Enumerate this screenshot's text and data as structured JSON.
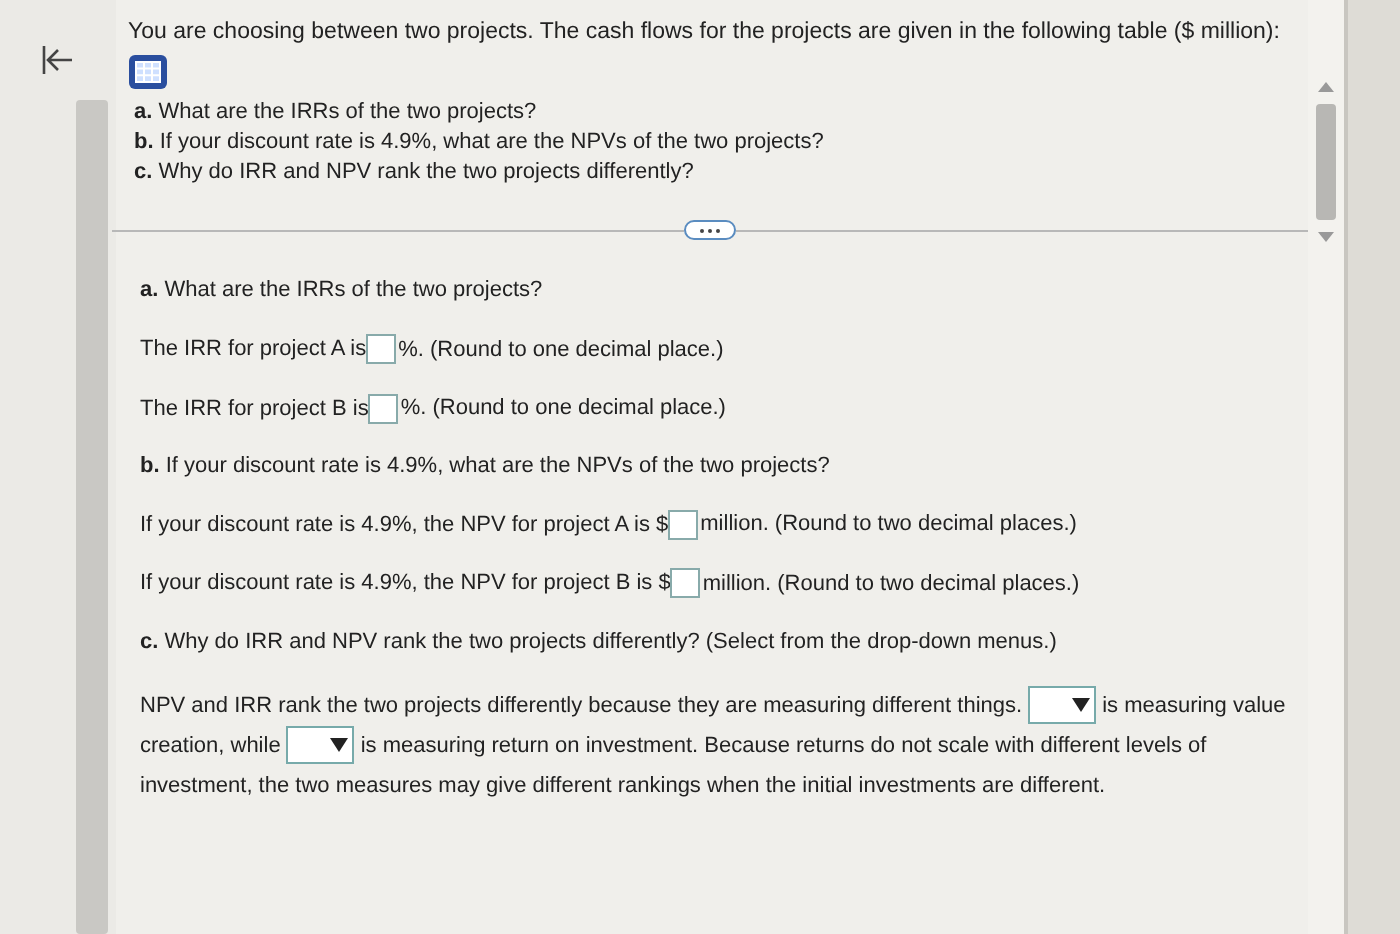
{
  "question": {
    "intro": "You are choosing between two projects. The cash flows for the projects are given in the following table ($ million):",
    "parts": [
      "**a.** What are the IRRs of the two projects?",
      "**b.** If your discount rate is 4.9%, what are the NPVs of the two projects?",
      "**c.** Why do IRR and NPV rank the two projects differently?"
    ]
  },
  "answers": [
    {
      "kind": "heading",
      "text": "**a.** What are the IRRs of the two projects?"
    },
    {
      "kind": "blank",
      "before": "The IRR for project A is",
      "after": "%. (Round to one decimal place.)"
    },
    {
      "kind": "blank",
      "before": "The IRR for project B is",
      "after": "%. (Round to one decimal place.)"
    },
    {
      "kind": "heading",
      "text": "**b.** If your discount rate is 4.9%, what are the NPVs of the two projects?"
    },
    {
      "kind": "blank",
      "before": "If your discount rate is 4.9%, the NPV for project A is $",
      "after": "million. (Round to two decimal places.)"
    },
    {
      "kind": "blank",
      "before": "If your discount rate is 4.9%, the NPV for project B is $",
      "after": "million. (Round to two decimal places.)"
    },
    {
      "kind": "heading",
      "text": "**c.** Why do IRR and NPV rank the two projects differently? (Select from the drop-down menus.)"
    },
    {
      "kind": "paragraph",
      "lines": [
        [
          {
            "kind": "text",
            "text": "NPV and IRR rank the two projects differently because they are measuring different things."
          },
          {
            "kind": "dropdown"
          },
          {
            "kind": "text",
            "text": "is measuring value"
          }
        ],
        [
          {
            "kind": "text",
            "text": "creation, while"
          },
          {
            "kind": "dropdown"
          },
          {
            "kind": "text",
            "text": "is measuring return on investment. Because returns do not scale with different levels of"
          }
        ],
        [
          {
            "kind": "text",
            "text": "investment, the two measures may give different rankings when the initial investments are different."
          }
        ]
      ]
    }
  ]
}
